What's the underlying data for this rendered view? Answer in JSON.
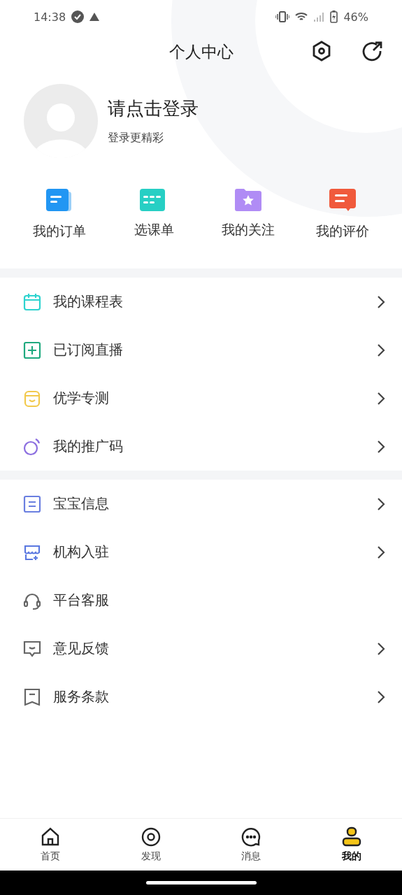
{
  "status_bar": {
    "time": "14:38",
    "battery": "46%"
  },
  "header": {
    "title": "个人中心"
  },
  "profile": {
    "name": "请点击登录",
    "subtitle": "登录更精彩"
  },
  "shortcuts": [
    {
      "label": "我的订单"
    },
    {
      "label": "选课单"
    },
    {
      "label": "我的关注"
    },
    {
      "label": "我的评价"
    }
  ],
  "menu_groups": [
    [
      {
        "label": "我的课程表",
        "color": "#2ed3cf",
        "chevron": true
      },
      {
        "label": "已订阅直播",
        "color": "#1fa97f",
        "chevron": true
      },
      {
        "label": "优学专测",
        "color": "#f2c94c",
        "chevron": true
      },
      {
        "label": "我的推广码",
        "color": "#8c6fe0",
        "chevron": true
      }
    ],
    [
      {
        "label": "宝宝信息",
        "color": "#6a7fe0",
        "chevron": true
      },
      {
        "label": "机构入驻",
        "color": "#5a78e0",
        "chevron": true
      },
      {
        "label": "平台客服",
        "color": "#666666",
        "chevron": false
      },
      {
        "label": "意见反馈",
        "color": "#666666",
        "chevron": true
      },
      {
        "label": "服务条款",
        "color": "#666666",
        "chevron": true
      }
    ]
  ],
  "tab_bar": [
    {
      "label": "首页",
      "selected": false
    },
    {
      "label": "发现",
      "selected": false
    },
    {
      "label": "消息",
      "selected": false
    },
    {
      "label": "我的",
      "selected": true
    }
  ]
}
